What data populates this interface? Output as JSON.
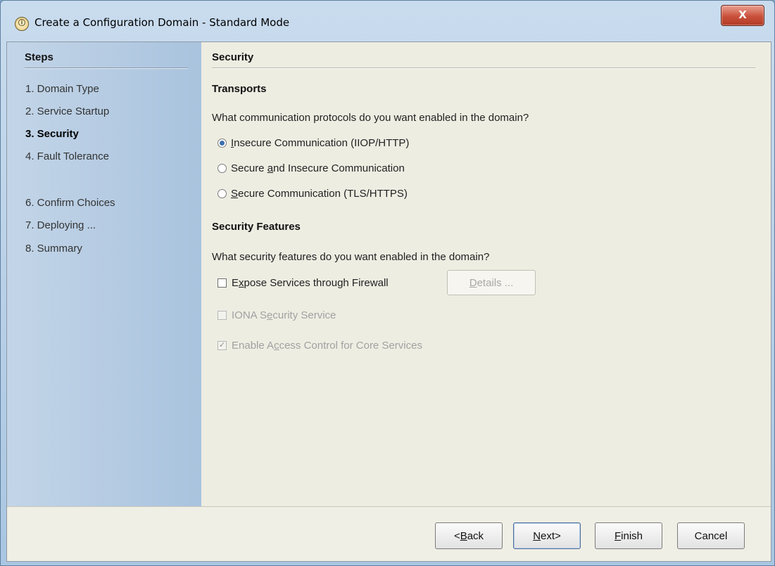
{
  "window": {
    "title": "Create a Configuration Domain - Standard Mode",
    "icon": "iona-app-icon",
    "close_label": "X"
  },
  "sidebar": {
    "heading": "Steps",
    "items": [
      {
        "label": "1. Domain Type",
        "active": false
      },
      {
        "label": "2. Service Startup",
        "active": false
      },
      {
        "label": "3. Security",
        "active": true
      },
      {
        "label": "4. Fault Tolerance",
        "active": false
      },
      {
        "label": "6. Confirm Choices",
        "active": false
      },
      {
        "label": "7. Deploying ...",
        "active": false
      },
      {
        "label": "8. Summary",
        "active": false
      }
    ]
  },
  "main": {
    "title": "Security",
    "transports": {
      "heading": "Transports",
      "question": "What communication protocols do you want enabled in the domain?",
      "options": [
        {
          "pre": "",
          "mnemonic": "I",
          "post": "nsecure Communication (IIOP/HTTP)",
          "selected": true
        },
        {
          "pre": "Secure ",
          "mnemonic": "a",
          "post": "nd Insecure Communication",
          "selected": false
        },
        {
          "pre": "",
          "mnemonic": "S",
          "post": "ecure Communication (TLS/HTTPS)",
          "selected": false
        }
      ]
    },
    "features": {
      "heading": "Security Features",
      "question": "What security features do you want enabled in the domain?",
      "expose": {
        "pre": "E",
        "mnemonic": "x",
        "post": "pose Services through Firewall",
        "checked": false,
        "enabled": true
      },
      "details": {
        "mnemonic": "D",
        "post": "etails ..."
      },
      "iona": {
        "pre": "IONA S",
        "mnemonic": "e",
        "post": "curity Service",
        "checked": false,
        "enabled": false
      },
      "access": {
        "pre": "Enable A",
        "mnemonic": "c",
        "post": "cess Control for Core Services",
        "checked": true,
        "enabled": false
      }
    }
  },
  "footer": {
    "back": {
      "pre": "<",
      "mnemonic": "B",
      "post": "ack"
    },
    "next": {
      "pre": "",
      "mnemonic": "N",
      "post": "ext>"
    },
    "finish": {
      "pre": "",
      "mnemonic": "F",
      "post": "inish"
    },
    "cancel": {
      "label": "Cancel"
    }
  }
}
